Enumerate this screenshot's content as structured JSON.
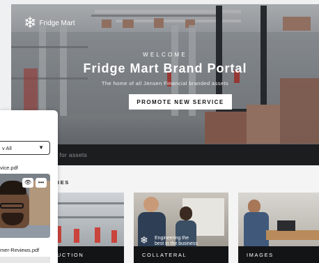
{
  "brand": {
    "logo_text": "Fridge Mart",
    "logo_icon": "snowflake-icon"
  },
  "hero": {
    "eyebrow": "WELCOME",
    "title": "Fridge Mart Brand Portal",
    "subtitle": "The home of all Jensen Financial branded assets",
    "cta_label": "PROMOTE NEW SERVICE"
  },
  "search": {
    "placeholder": "rch for assets"
  },
  "categories": {
    "heading": "RIES",
    "items": [
      {
        "label": "UCTION"
      },
      {
        "label": "COLLATERAL",
        "overlay_text_line1": "Engineering the",
        "overlay_text_line2": "best in the business"
      },
      {
        "label": "IMAGES"
      }
    ]
  },
  "panel": {
    "filter_value": "v All",
    "file1": "vice.pdf",
    "file2": "mer-Reviews.pdf",
    "actions": {
      "view_icon": "eye-icon",
      "more_icon": "more-icon"
    }
  },
  "colors": {
    "cta_bg": "#ffffff",
    "search_bg": "#1c1d1f",
    "card_bar": "#131416"
  }
}
